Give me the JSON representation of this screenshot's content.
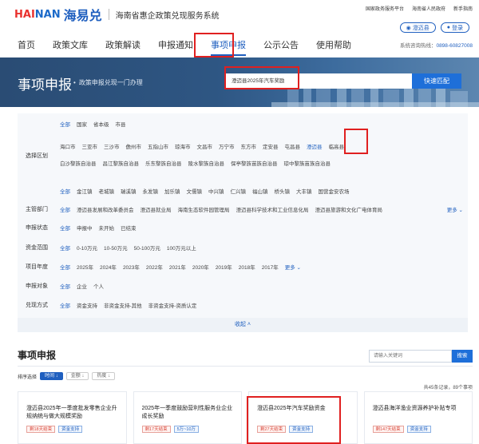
{
  "header": {
    "logo_text_red": "HAI",
    "logo_text_blue": "NAN",
    "brand": "海易兑",
    "site_name": "海南省惠企政策兑现服务系统",
    "top_links": [
      "国家政务服务平台",
      "海南省人民政府",
      "新手指南"
    ],
    "location_label": "澄迈县",
    "login_label": "登录",
    "hotline_label": "系统咨询热线：",
    "hotline_number": "0898-60827008"
  },
  "nav": {
    "items": [
      "首页",
      "政策文库",
      "政策解读",
      "申报通知",
      "事项申报",
      "公示公告",
      "使用帮助"
    ],
    "active_index": 4
  },
  "banner": {
    "title": "事项申报",
    "subtitle": "政策申报兑现一门办理",
    "search_value": "澄迈县2025年汽车奖励",
    "search_button": "快速匹配"
  },
  "filters": {
    "region": {
      "label": "选择区划",
      "level1": [
        "全部",
        "国家",
        "省本级",
        "市县"
      ],
      "row1": [
        "海口市",
        "三亚市",
        "三沙市",
        "儋州市",
        "五指山市",
        "琼海市",
        "文昌市",
        "万宁市",
        "东方市",
        "定安县",
        "屯昌县",
        "澄迈县",
        "临高县"
      ],
      "row2": [
        "白沙黎族自治县",
        "昌江黎族自治县",
        "乐东黎族自治县",
        "陵水黎族自治县",
        "保亭黎族苗族自治县",
        "琼中黎族苗族自治县"
      ],
      "row3": [
        "全部",
        "金江镇",
        "老城镇",
        "瑞溪镇",
        "永发镇",
        "加乐镇",
        "文儒镇",
        "中兴镇",
        "仁兴镇",
        "福山镇",
        "桥头镇",
        "大丰镇",
        "国营金安农场"
      ],
      "selected": "澄迈县"
    },
    "department": {
      "label": "主管部门",
      "options": [
        "全部",
        "澄迈县发展和改革委员会",
        "澄迈县就业局",
        "海南生态软件园管理局",
        "澄迈县科学技术和工业信息化局",
        "澄迈县旅游和文化广电体育局"
      ],
      "more": "更多"
    },
    "status": {
      "label": "申报状态",
      "options": [
        "全部",
        "申报中",
        "未开始",
        "已结束"
      ]
    },
    "funds": {
      "label": "资金范围",
      "options": [
        "全部",
        "0-10万元",
        "10-50万元",
        "50-100万元",
        "100万元以上"
      ]
    },
    "year": {
      "label": "项目年度",
      "options": [
        "全部",
        "2025年",
        "2024年",
        "2023年",
        "2022年",
        "2021年",
        "2020年",
        "2019年",
        "2018年",
        "2017年"
      ],
      "more": "更多"
    },
    "target": {
      "label": "申报对象",
      "options": [
        "全部",
        "企业",
        "个人"
      ]
    },
    "method": {
      "label": "兑现方式",
      "options": [
        "全部",
        "资金支持",
        "非资金支持-其他",
        "非资金支持-资质认定"
      ]
    },
    "collapse_label": "收起"
  },
  "results": {
    "title": "事项申报",
    "search_placeholder": "请输入关键词",
    "search_button": "搜索",
    "sort_label": "排序选择",
    "sort_options": [
      "时间",
      "金额",
      "热度"
    ],
    "totals": "共45条记录，89个事项",
    "cards": [
      {
        "title": "澄迈县2025年一季度批发零售企业升规纳统与做大规模奖励",
        "tags": [
          "剩18天结束",
          "资金支持"
        ]
      },
      {
        "title": "2025年一季度鼓励营利性服务业企业成长奖励",
        "tags": [
          "剩17天结束",
          "5万~10万"
        ]
      },
      {
        "title": "澄迈县2025年汽车奖励资金",
        "tags": [
          "剩27天结束",
          "资金支持"
        ]
      },
      {
        "title": "澄迈县海洋渔业资源养护补贴专项",
        "tags": [
          "剩147天结束",
          "资金支持"
        ]
      }
    ]
  },
  "colors": {
    "primary": "#1f5fbf",
    "highlight_box": "#e02020",
    "banner": "#2e5683"
  }
}
